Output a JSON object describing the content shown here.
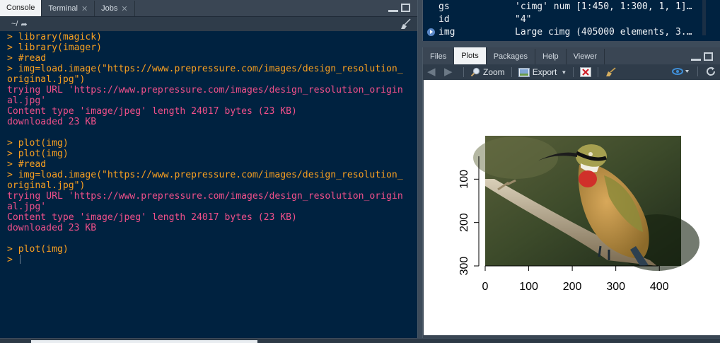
{
  "console_pane": {
    "tabs": [
      {
        "label": "Console",
        "active": true,
        "closable": false
      },
      {
        "label": "Terminal",
        "active": false,
        "closable": true
      },
      {
        "label": "Jobs",
        "active": false,
        "closable": true
      }
    ],
    "path": "~/",
    "lines": [
      {
        "type": "in",
        "text": "> library(magick)"
      },
      {
        "type": "in",
        "text": "> library(imager)"
      },
      {
        "type": "in",
        "text": "> #read"
      },
      {
        "type": "in",
        "text": "> img=load.image(\"https://www.prepressure.com/images/design_resolution_"
      },
      {
        "type": "in",
        "text": "original.jpg\")"
      },
      {
        "type": "out",
        "text": "trying URL 'https://www.prepressure.com/images/design_resolution_origin"
      },
      {
        "type": "out",
        "text": "al.jpg'"
      },
      {
        "type": "out",
        "text": "Content type 'image/jpeg' length 24017 bytes (23 KB)"
      },
      {
        "type": "out",
        "text": "downloaded 23 KB"
      },
      {
        "type": "out",
        "text": ""
      },
      {
        "type": "in",
        "text": "> plot(img)"
      },
      {
        "type": "in",
        "text": "> plot(img)"
      },
      {
        "type": "in",
        "text": "> #read"
      },
      {
        "type": "in",
        "text": "> img=load.image(\"https://www.prepressure.com/images/design_resolution_"
      },
      {
        "type": "in",
        "text": "original.jpg\")"
      },
      {
        "type": "out",
        "text": "trying URL 'https://www.prepressure.com/images/design_resolution_origin"
      },
      {
        "type": "out",
        "text": "al.jpg'"
      },
      {
        "type": "out",
        "text": "Content type 'image/jpeg' length 24017 bytes (23 KB)"
      },
      {
        "type": "out",
        "text": "downloaded 23 KB"
      },
      {
        "type": "out",
        "text": ""
      },
      {
        "type": "in",
        "text": "> plot(img)"
      }
    ],
    "prompt": ">"
  },
  "environment_pane": {
    "rows": [
      {
        "name": "gs",
        "value": "'cimg' num [1:450, 1:300, 1, 1]…",
        "expandable": false
      },
      {
        "name": "id",
        "value": "\"4\"",
        "expandable": false
      },
      {
        "name": "img",
        "value": "Large cimg (405000 elements, 3.…",
        "expandable": true
      }
    ]
  },
  "plots_pane": {
    "tabs": [
      {
        "label": "Files",
        "active": false
      },
      {
        "label": "Plots",
        "active": true
      },
      {
        "label": "Packages",
        "active": false
      },
      {
        "label": "Help",
        "active": false
      },
      {
        "label": "Viewer",
        "active": false
      }
    ],
    "toolbar": {
      "zoom_label": "Zoom",
      "export_label": "Export"
    },
    "plot": {
      "x_ticks": [
        "0",
        "100",
        "200",
        "300",
        "400"
      ],
      "y_ticks": [
        "100",
        "200",
        "300"
      ]
    }
  },
  "colors": {
    "console_bg": "#002240",
    "input_text": "#f8a020",
    "output_text": "#f0508a",
    "chrome": "#3a4654"
  }
}
